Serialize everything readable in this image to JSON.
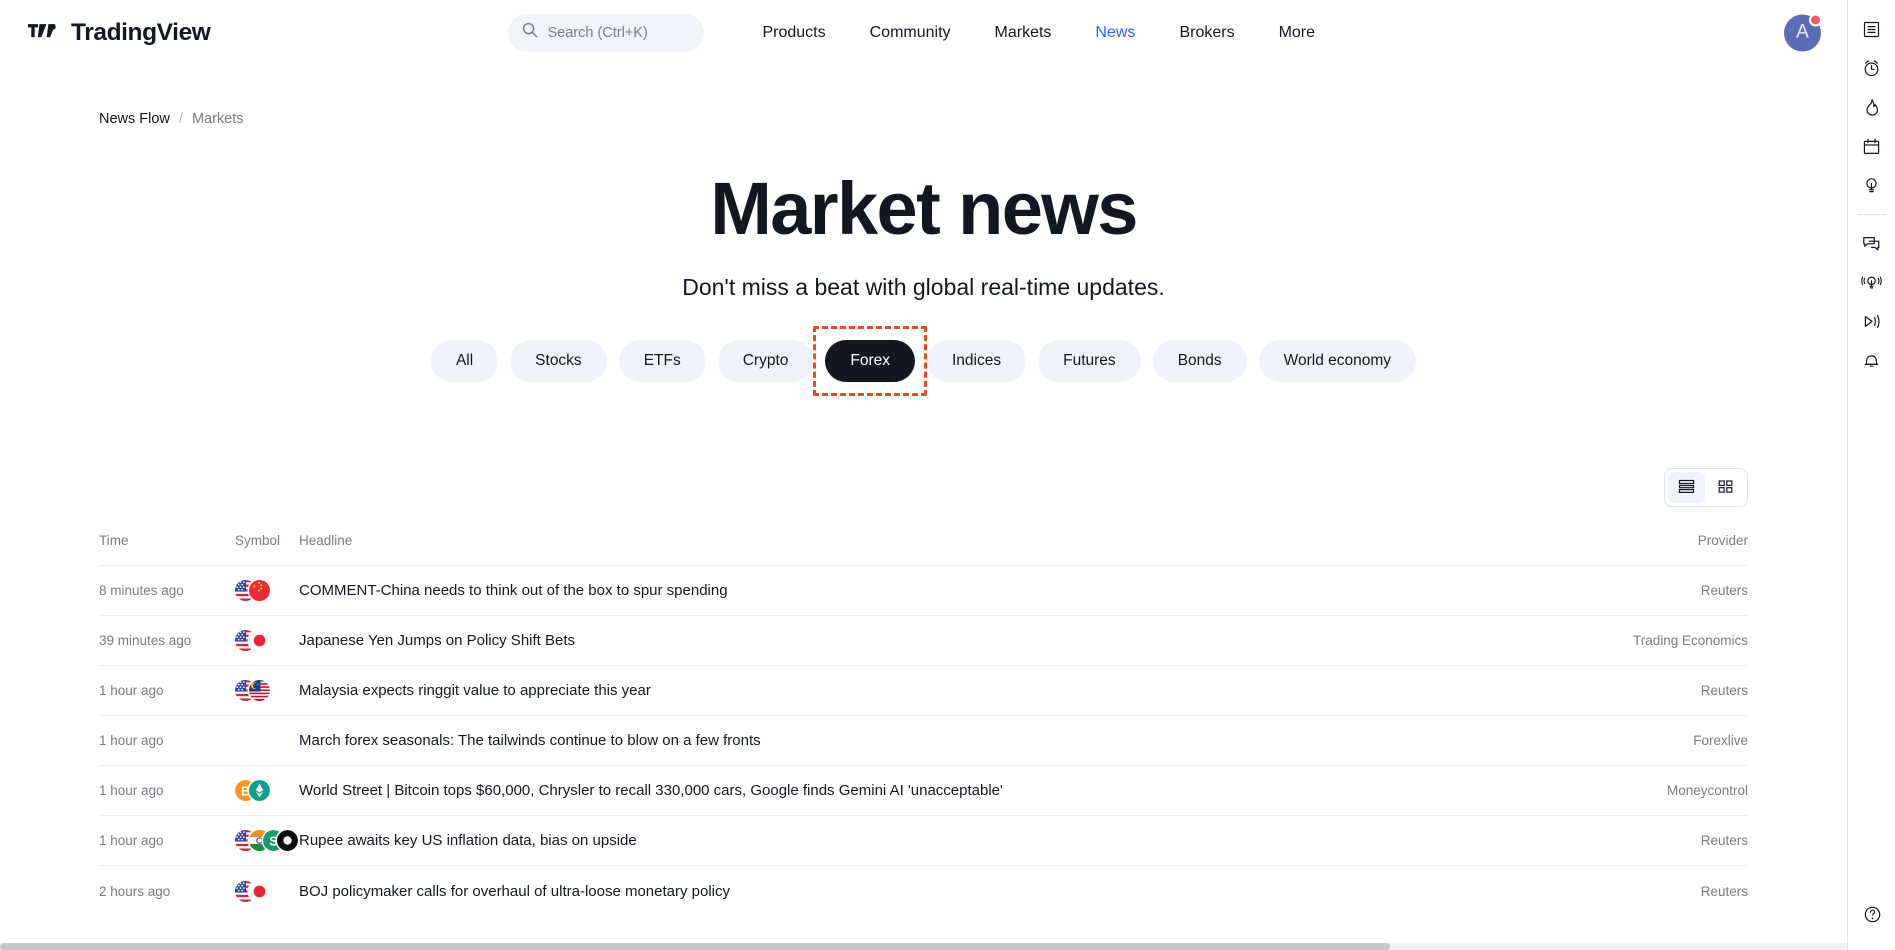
{
  "brand": {
    "name": "TradingView",
    "logo_icon": "tradingview-logo-icon"
  },
  "search": {
    "placeholder": "Search (Ctrl+K)",
    "icon": "search-icon"
  },
  "nav": {
    "items": [
      {
        "label": "Products",
        "active": false
      },
      {
        "label": "Community",
        "active": false
      },
      {
        "label": "Markets",
        "active": false
      },
      {
        "label": "News",
        "active": true
      },
      {
        "label": "Brokers",
        "active": false
      },
      {
        "label": "More",
        "active": false
      }
    ],
    "active_color": "#2962ff"
  },
  "account": {
    "initial": "A",
    "avatar_color": "#5b6bb5",
    "badge_color": "#f7525f",
    "has_notification": true
  },
  "breadcrumb": {
    "root": "News Flow",
    "separator": "/",
    "current": "Markets"
  },
  "hero": {
    "title": "Market news",
    "subtitle": "Don't miss a beat with global real-time updates."
  },
  "filters": {
    "active": "Forex",
    "highlight_color": "#f04622",
    "items": [
      {
        "label": "All"
      },
      {
        "label": "Stocks"
      },
      {
        "label": "ETFs"
      },
      {
        "label": "Crypto"
      },
      {
        "label": "Forex"
      },
      {
        "label": "Indices"
      },
      {
        "label": "Futures"
      },
      {
        "label": "Bonds"
      },
      {
        "label": "World economy"
      }
    ]
  },
  "view_toggle": {
    "active": "list",
    "options": [
      {
        "name": "list",
        "icon": "list-view-icon"
      },
      {
        "name": "grid",
        "icon": "grid-view-icon"
      }
    ]
  },
  "table": {
    "columns": {
      "time": "Time",
      "symbol": "Symbol",
      "headline": "Headline",
      "provider": "Provider"
    },
    "rows": [
      {
        "time": "8 minutes ago",
        "symbols": [
          "flag-us",
          "flag-cn"
        ],
        "headline": "COMMENT-China needs to think out of the box to spur spending",
        "provider": "Reuters"
      },
      {
        "time": "39 minutes ago",
        "symbols": [
          "flag-us",
          "flag-jp"
        ],
        "headline": "Japanese Yen Jumps on Policy Shift Bets",
        "provider": "Trading Economics"
      },
      {
        "time": "1 hour ago",
        "symbols": [
          "flag-us",
          "flag-my"
        ],
        "headline": "Malaysia expects ringgit value to appreciate this year",
        "provider": "Reuters"
      },
      {
        "time": "1 hour ago",
        "symbols": [],
        "headline": "March forex seasonals: The tailwinds continue to blow on a few fronts",
        "provider": "Forexlive"
      },
      {
        "time": "1 hour ago",
        "symbols": [
          "coin-btc",
          "coin-eth"
        ],
        "headline": "World Street | Bitcoin tops $60,000, Chrysler to recall 330,000 cars, Google finds Gemini AI 'unacceptable'",
        "provider": "Moneycontrol"
      },
      {
        "time": "1 hour ago",
        "symbols": [
          "flag-us",
          "flag-in",
          "coin-usdt",
          "coin-dark"
        ],
        "headline": "Rupee awaits key US inflation data, bias on upside",
        "provider": "Reuters"
      },
      {
        "time": "2 hours ago",
        "symbols": [
          "flag-us",
          "flag-jp"
        ],
        "headline": "BOJ policymaker calls for overhaul of ultra-loose monetary policy",
        "provider": "Reuters"
      }
    ]
  },
  "right_rail": {
    "top_items": [
      {
        "name": "watchlist-icon"
      },
      {
        "name": "alarm-clock-icon"
      },
      {
        "name": "flame-icon"
      },
      {
        "name": "calendar-icon"
      },
      {
        "name": "lightbulb-icon"
      }
    ],
    "bottom_items": [
      {
        "name": "chat-bubbles-icon"
      },
      {
        "name": "ideas-broadcast-icon"
      },
      {
        "name": "stream-play-icon"
      },
      {
        "name": "bell-icon"
      }
    ],
    "help": {
      "name": "help-icon"
    }
  }
}
